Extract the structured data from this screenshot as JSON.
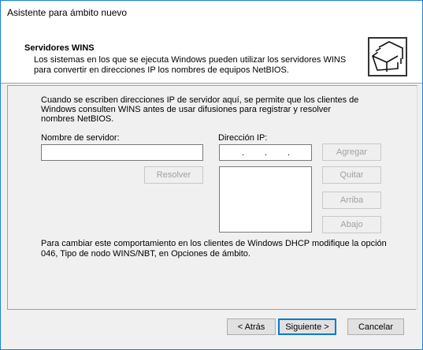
{
  "window": {
    "title": "Asistente para ámbito nuevo"
  },
  "header": {
    "title": "Servidores WINS",
    "description": "Los sistemas en los que se ejecuta Windows pueden utilizar los servidores WINS para convertir en direcciones IP los nombres de equipos NetBIOS.",
    "icon": "folders-icon"
  },
  "body": {
    "intro": "Cuando se escriben direcciones IP de servidor aquí, se permite que los clientes de Windows consulten WINS antes de usar difusiones para registrar y resolver nombres NetBIOS.",
    "server_name_label": "Nombre de servidor:",
    "server_name_value": "",
    "ip_label": "Dirección IP:",
    "ip_separator": ".",
    "resolve_button": "Resolver",
    "add_button": "Agregar",
    "remove_button": "Quitar",
    "up_button": "Arriba",
    "down_button": "Abajo",
    "note": "Para cambiar este comportamiento en los clientes de Windows DHCP modifique la opción 046, Tipo de nodo WINS/NBT, en Opciones de ámbito."
  },
  "footer": {
    "back_button": "< Atrás",
    "next_button": "Siguiente >",
    "cancel_button": "Cancelar"
  }
}
